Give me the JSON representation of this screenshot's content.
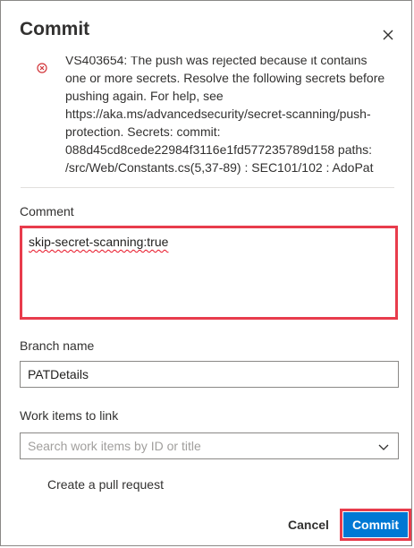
{
  "dialog": {
    "title": "Commit",
    "close_icon": "close-icon"
  },
  "error": {
    "icon": "error-circle-icon",
    "message": "VS403654: The push was rejected because it contains one or more secrets. Resolve the following secrets before pushing again. For help, see https://aka.ms/advancedsecurity/secret-scanning/push-protection. Secrets: commit: 088d45cd8cede22984f3116e1fd577235789d158 paths: /src/Web/Constants.cs(5,37-89) : SEC101/102 : AdoPat"
  },
  "comment": {
    "label": "Comment",
    "value": "skip-secret-scanning:true"
  },
  "branch": {
    "label": "Branch name",
    "value": "PATDetails"
  },
  "work_items": {
    "label": "Work items to link",
    "placeholder": "Search work items by ID or title",
    "chevron_icon": "chevron-down-icon"
  },
  "pull_request": {
    "label": "Create a pull request"
  },
  "footer": {
    "cancel_label": "Cancel",
    "commit_label": "Commit"
  },
  "colors": {
    "primary": "#0078d4",
    "highlight": "#e83c4c",
    "error": "#d13438"
  }
}
